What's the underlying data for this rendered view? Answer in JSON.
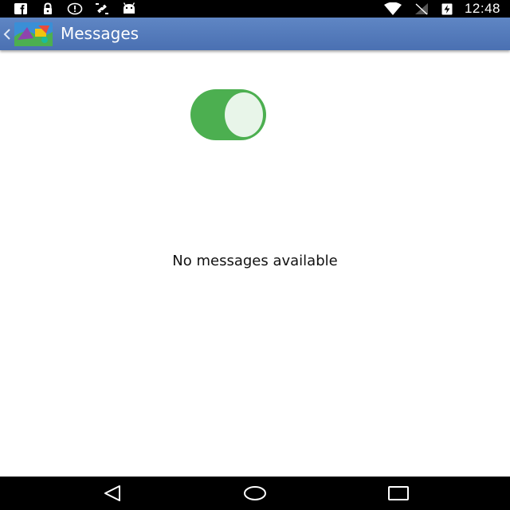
{
  "status_bar": {
    "time": "12:48",
    "left_icons": [
      "facebook-icon",
      "lock-icon",
      "alert-circle-icon",
      "satellite-icon",
      "android-icon"
    ],
    "right_icons": [
      "wifi-icon",
      "signal-off-icon",
      "battery-charging-icon"
    ]
  },
  "action_bar": {
    "title": "Messages",
    "up_icon": "chevron-left-icon",
    "logo": "app-logo",
    "color": "#4f76b8"
  },
  "content": {
    "toggle": {
      "on": true,
      "color": "#4caf50"
    },
    "empty_message": "No messages available"
  },
  "nav_bar": {
    "buttons": [
      "back-triangle-icon",
      "home-circle-icon",
      "recents-square-icon"
    ]
  }
}
